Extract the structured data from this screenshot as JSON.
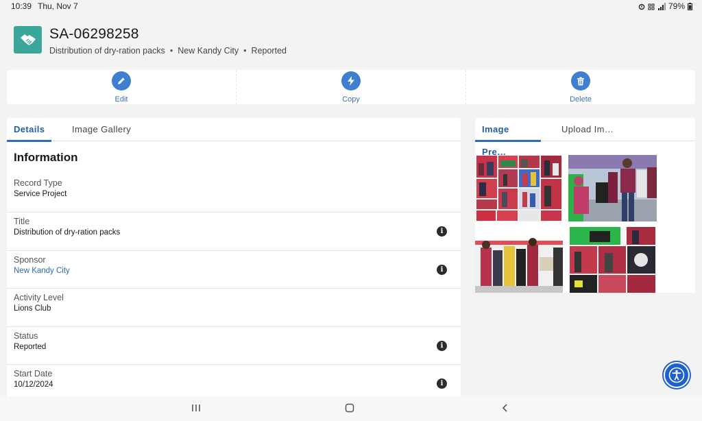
{
  "status_bar": {
    "time": "10:39",
    "date": "Thu, Nov 7",
    "battery": "79%"
  },
  "record": {
    "icon": "handshake-icon",
    "id": "SA-06298258",
    "subtitle": [
      "Distribution of dry-ration packs",
      "New Kandy City",
      "Reported"
    ],
    "separator": "•"
  },
  "actions": [
    {
      "label": "Edit",
      "icon": "pencil-icon"
    },
    {
      "label": "Copy",
      "icon": "lightning-icon"
    },
    {
      "label": "Delete",
      "icon": "trash-icon"
    }
  ],
  "left_tabs": [
    {
      "label": "Details",
      "active": true
    },
    {
      "label": "Image Gallery",
      "active": false
    }
  ],
  "section_title": "Information",
  "fields": [
    {
      "label": "Record Type",
      "value": "Service Project",
      "link": false,
      "info": false
    },
    {
      "label": "Title",
      "value": "Distribution of dry-ration packs",
      "link": false,
      "info": true
    },
    {
      "label": "Sponsor",
      "value": "New Kandy City",
      "link": true,
      "info": true
    },
    {
      "label": "Activity Level",
      "value": "Lions Club",
      "link": false,
      "info": false
    },
    {
      "label": "Status",
      "value": "Reported",
      "link": false,
      "info": true
    },
    {
      "label": "Start Date",
      "value": "10/12/2024",
      "link": false,
      "info": true
    }
  ],
  "info_glyph": "i",
  "right_tabs": [
    {
      "label": "Image Pre…",
      "active": true
    },
    {
      "label": "Upload Im…",
      "active": false
    }
  ],
  "colors": {
    "accent": "#3e7fd1",
    "record_icon_bg": "#3ba79a",
    "link": "#2a6cb5",
    "accessibility_button": "#1f5fd1"
  },
  "accessibility_button_icon": "accessibility-icon",
  "nav_icons": [
    "recent-apps-icon",
    "home-icon",
    "back-icon"
  ]
}
